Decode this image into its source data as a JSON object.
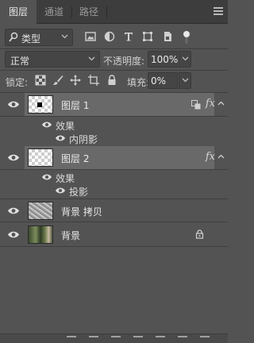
{
  "tabs": [
    {
      "label": "图层",
      "active": true
    },
    {
      "label": "通道",
      "active": false
    },
    {
      "label": "路径",
      "active": false
    }
  ],
  "filter": {
    "kind_label": "类型",
    "icons": [
      "image-filter-icon",
      "adjustment-filter-icon",
      "type-filter-icon",
      "shape-filter-icon",
      "smart-object-filter-icon"
    ]
  },
  "blend": {
    "mode": "正常",
    "opacity_label": "不透明度:",
    "opacity_value": "100%"
  },
  "lock": {
    "label": "锁定:",
    "fill_label": "填充:",
    "fill_value": "0%"
  },
  "layers": [
    {
      "name": "图层 1",
      "selected": true,
      "has_fx": true,
      "effects_label": "效果",
      "effects": [
        "内阴影"
      ]
    },
    {
      "name": "图层 2",
      "selected": true,
      "has_fx": true,
      "effects_label": "效果",
      "effects": [
        "投影"
      ]
    },
    {
      "name": "背景 拷贝",
      "selected": false
    },
    {
      "name": "背景",
      "selected": false,
      "locked": true
    }
  ],
  "colors": {
    "panel_bg": "#535353",
    "selected_row": "#696969",
    "tabbar_bg": "#3d3d3d"
  }
}
